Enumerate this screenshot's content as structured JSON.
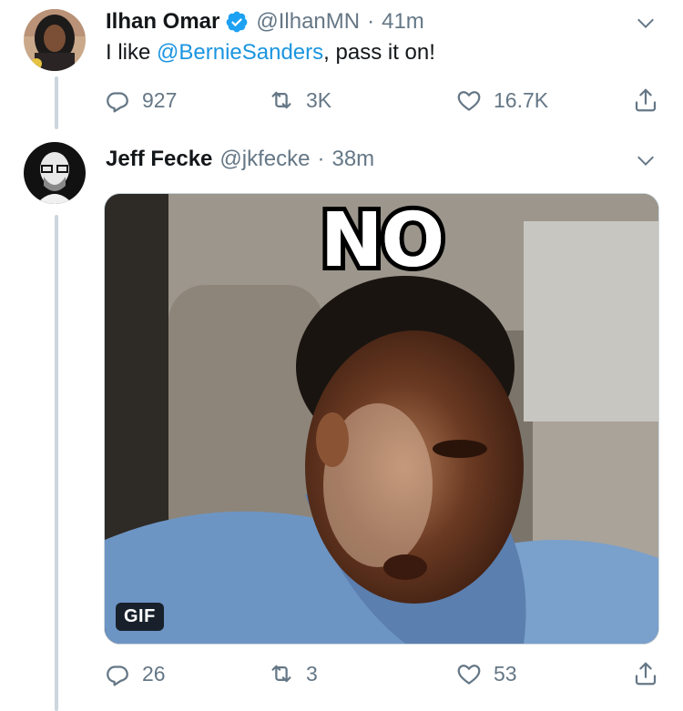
{
  "tweets": [
    {
      "display_name": "Ilhan Omar",
      "verified": true,
      "handle": "@IlhanMN",
      "separator": "·",
      "time": "41m",
      "text_prefix": "I like ",
      "mention": "@BernieSanders",
      "text_suffix": ", pass it on!",
      "replies": "927",
      "retweets": "3K",
      "likes": "16.7K"
    },
    {
      "display_name": "Jeff Fecke",
      "handle": "@jkfecke",
      "separator": "·",
      "time": "38m",
      "media": {
        "type": "gif",
        "overlay_text": "NO",
        "badge": "GIF"
      },
      "replies": "26",
      "retweets": "3",
      "likes": "53"
    }
  ],
  "colors": {
    "text_primary": "#14171a",
    "text_secondary": "#657786",
    "link": "#1b95e0",
    "verified": "#1da1f2",
    "thread_line": "#ccd6dd"
  },
  "icons": [
    "reply-icon",
    "retweet-icon",
    "like-icon",
    "share-icon",
    "verified-badge-icon",
    "chevron-down-icon"
  ]
}
